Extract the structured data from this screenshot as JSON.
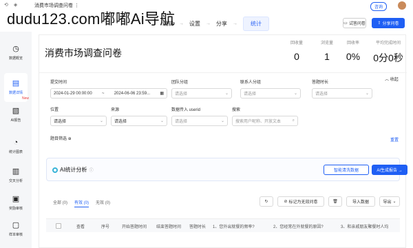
{
  "topbar": {
    "survey_tab": "消费市场调查问卷 ⋮",
    "watermark": "dudu123.com嘟嘟Ai导航",
    "steps": [
      "编辑",
      "设置",
      "分享",
      "统计"
    ],
    "active_step": "统计",
    "preview_label": "试答问卷",
    "share_label": "分享问卷",
    "upgrade_label": "咨询"
  },
  "sidebar": {
    "items": [
      {
        "label": "数据概览",
        "icon": "clock-icon"
      },
      {
        "label": "数据详情",
        "icon": "document-list-icon"
      },
      {
        "label": "AI报告",
        "icon": "ai-report-icon",
        "badge": "New"
      },
      {
        "label": "统计图表",
        "icon": "pie-chart-icon"
      },
      {
        "label": "交叉分析",
        "icon": "bar-chart-icon"
      },
      {
        "label": "奖励审核",
        "icon": "gift-icon"
      },
      {
        "label": "样本审核",
        "icon": "message-check-icon"
      }
    ]
  },
  "main": {
    "title": "消费市场调查问卷",
    "stats": [
      {
        "label": "回收量",
        "value": "0"
      },
      {
        "label": "浏览量",
        "value": "1"
      },
      {
        "label": "回收率",
        "value": "0%"
      },
      {
        "label": "平均完成时间",
        "value": "0分0秒"
      }
    ]
  },
  "filters": {
    "collapse_label": "收起",
    "submit_time": {
      "label": "提交时间",
      "start": "2024-01-29 00:00:00",
      "end": "2024-06-06 23:59..."
    },
    "team_group": {
      "label": "团队分组",
      "placeholder": "请选择"
    },
    "contact_group": {
      "label": "联系人分组",
      "placeholder": "请选择"
    },
    "answer_duration": {
      "label": "答题时长",
      "placeholder": "请选择"
    },
    "location": {
      "label": "位置",
      "placeholder": "请选择"
    },
    "source": {
      "label": "来源",
      "placeholder": "请选择"
    },
    "userid": {
      "label": "数据传入 userid",
      "placeholder": "请选择"
    },
    "search": {
      "label": "搜索",
      "placeholder": "搜索用户昵称、开放文本"
    },
    "question_filter": "题目筛选 ⊕",
    "reset_label": "重置"
  },
  "ai": {
    "title": "AI统计分析",
    "clean_button": "智能清洗数据",
    "report_button": "AI生成报告 →"
  },
  "data_tabs": [
    "全部 (0)",
    "有效 (0)",
    "无效 (0)"
  ],
  "active_data_tab": "有效 (0)",
  "tools": {
    "mark_invalid": "标记为无效问卷",
    "import": "导入数据",
    "export": "导出"
  },
  "table": {
    "columns": [
      "查看",
      "序号",
      "开始答题时间",
      "结束答题时间",
      "答题时长",
      "1、您外出就餐的频率?",
      "2、您经常在外就餐的原因?",
      "3、和亲戚朋友聚餐时人均"
    ]
  }
}
